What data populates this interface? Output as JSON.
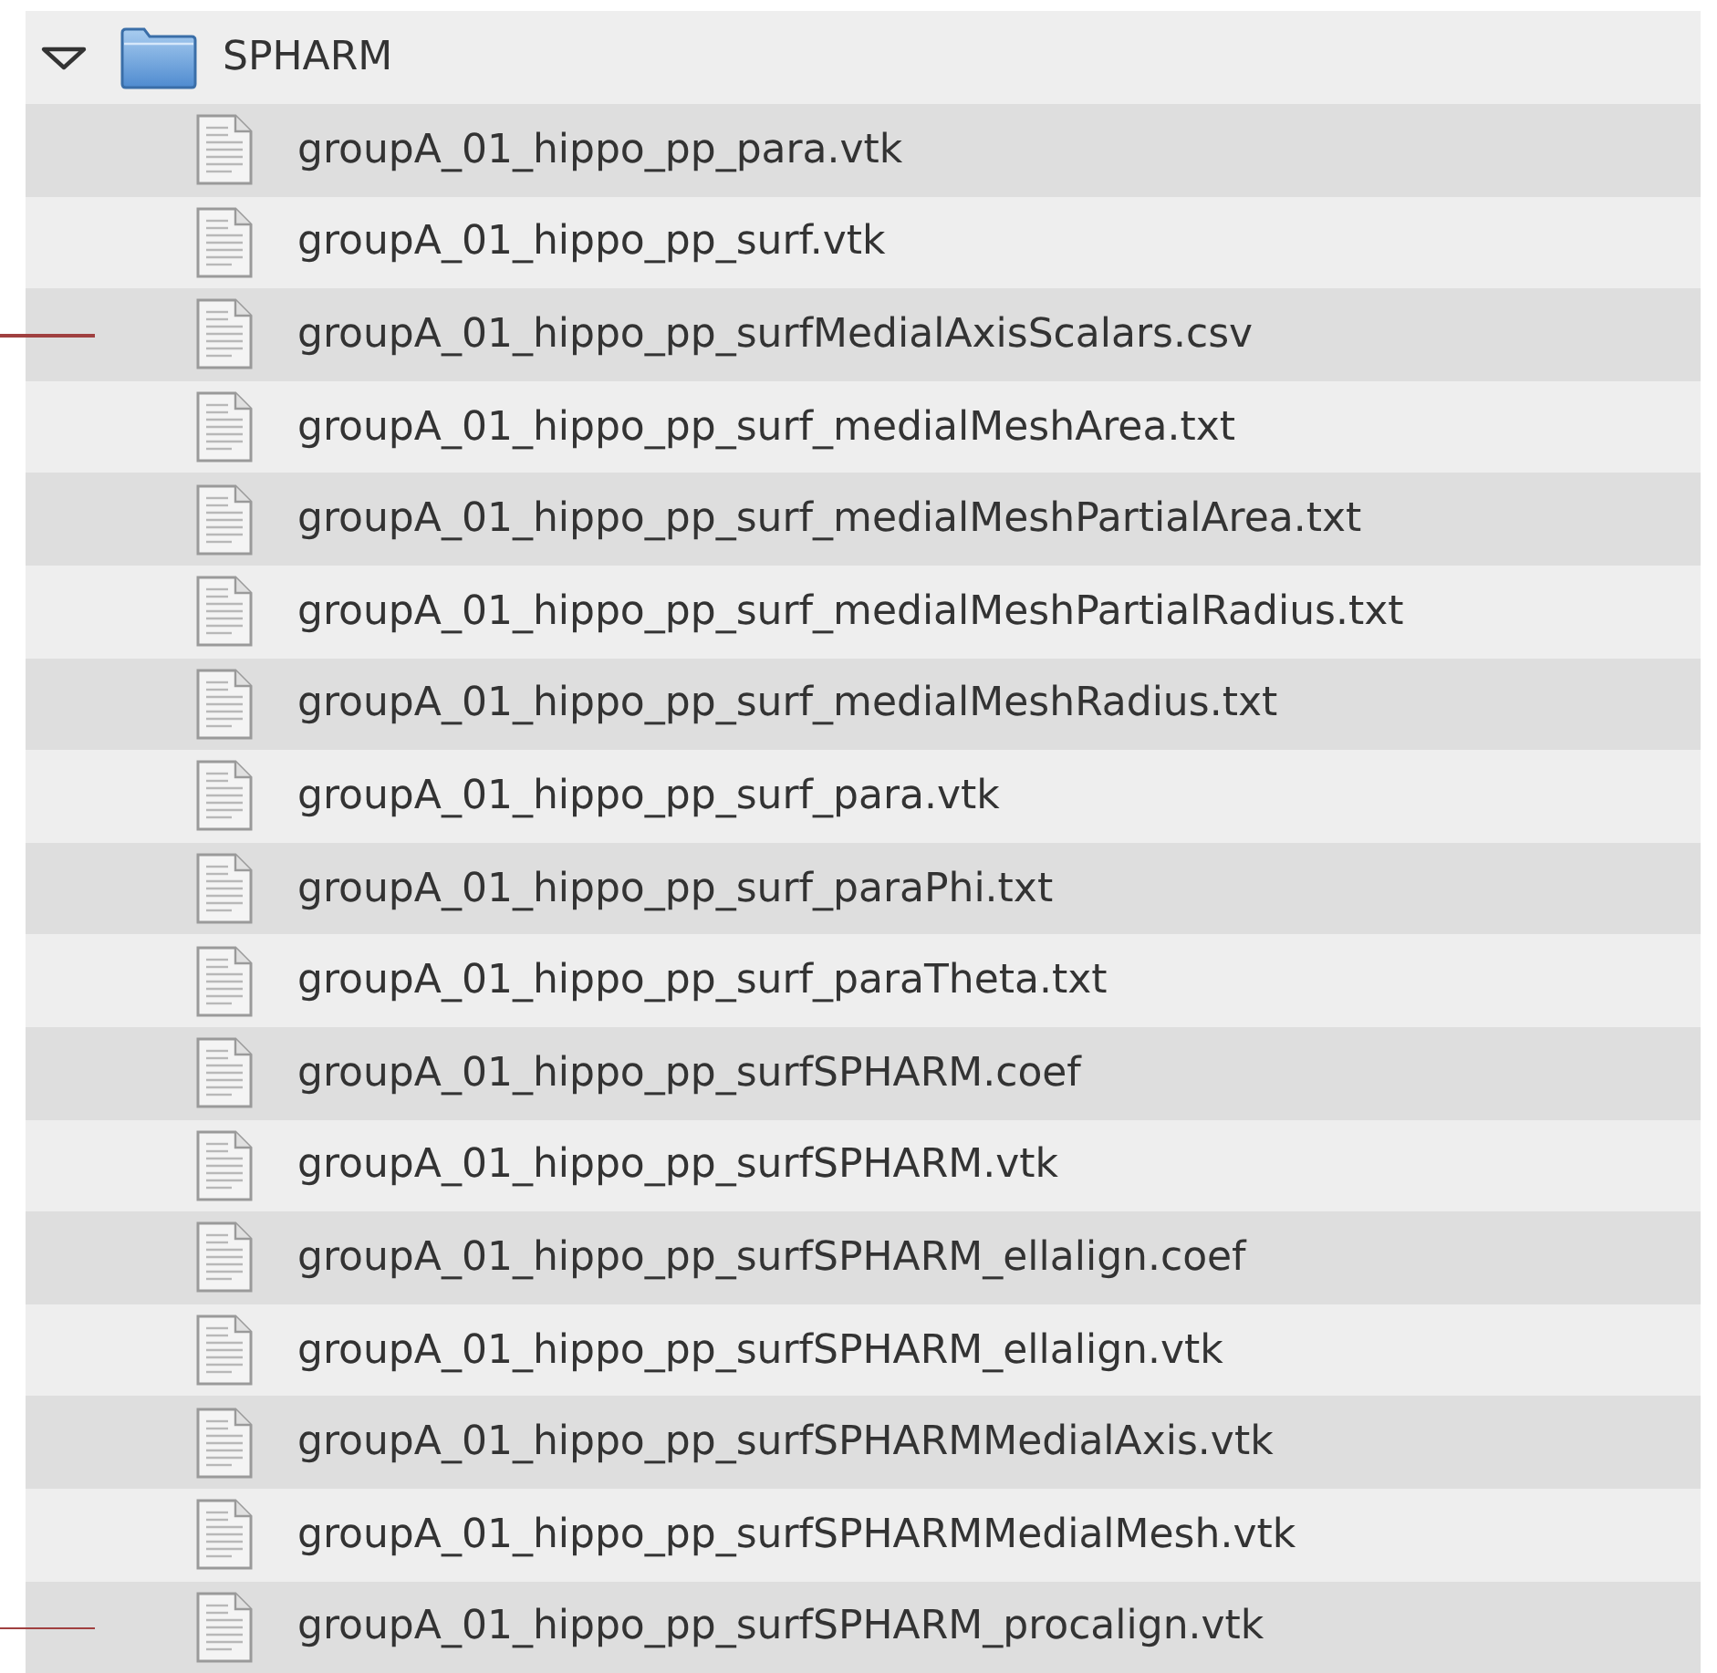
{
  "folder": {
    "name": "SPHARM",
    "expanded": true,
    "children": [
      {
        "name": "groupA_01_hippo_pp_para.vtk",
        "marked": false
      },
      {
        "name": "groupA_01_hippo_pp_surf.vtk",
        "marked": false
      },
      {
        "name": "groupA_01_hippo_pp_surfMedialAxisScalars.csv",
        "marked": true
      },
      {
        "name": "groupA_01_hippo_pp_surf_medialMeshArea.txt",
        "marked": false
      },
      {
        "name": "groupA_01_hippo_pp_surf_medialMeshPartialArea.txt",
        "marked": false
      },
      {
        "name": "groupA_01_hippo_pp_surf_medialMeshPartialRadius.txt",
        "marked": false
      },
      {
        "name": "groupA_01_hippo_pp_surf_medialMeshRadius.txt",
        "marked": false
      },
      {
        "name": "groupA_01_hippo_pp_surf_para.vtk",
        "marked": false
      },
      {
        "name": "groupA_01_hippo_pp_surf_paraPhi.txt",
        "marked": false
      },
      {
        "name": "groupA_01_hippo_pp_surf_paraTheta.txt",
        "marked": false
      },
      {
        "name": "groupA_01_hippo_pp_surfSPHARM.coef",
        "marked": false
      },
      {
        "name": "groupA_01_hippo_pp_surfSPHARM.vtk",
        "marked": false
      },
      {
        "name": "groupA_01_hippo_pp_surfSPHARM_ellalign.coef",
        "marked": false
      },
      {
        "name": "groupA_01_hippo_pp_surfSPHARM_ellalign.vtk",
        "marked": false
      },
      {
        "name": "groupA_01_hippo_pp_surfSPHARMMedialAxis.vtk",
        "marked": false
      },
      {
        "name": "groupA_01_hippo_pp_surfSPHARMMedialMesh.vtk",
        "marked": false
      },
      {
        "name": "groupA_01_hippo_pp_surfSPHARM_procalign.vtk",
        "marked": true
      }
    ]
  }
}
